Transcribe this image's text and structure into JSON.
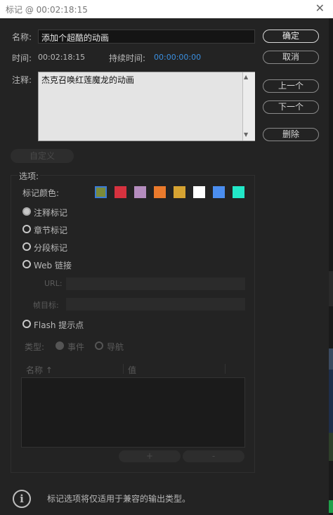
{
  "window": {
    "title": "标记 @ 00:02:18:15",
    "close": "✕"
  },
  "name": {
    "label": "名称:",
    "value": "添加个超酷的动画"
  },
  "time": {
    "label": "时间:",
    "value": "00:02:18:15",
    "duration_label": "持续时间:",
    "duration_value": "00:00:00:00"
  },
  "comment": {
    "label": "注释:",
    "value": "杰克召唤红莲魔龙的动画"
  },
  "buttons": {
    "ok": "确定",
    "cancel": "取消",
    "prev": "上一个",
    "next": "下一个",
    "delete": "删除",
    "custom": "自定义"
  },
  "options": {
    "legend": "选项:",
    "color_label": "标记颜色:",
    "colors": [
      "#7b8a3a",
      "#d6323f",
      "#b48cbe",
      "#ea7a2c",
      "#d6a332",
      "#ffffff",
      "#4b8ef0",
      "#22e8c8"
    ],
    "selected_color_index": 0,
    "types": [
      {
        "label": "注释标记",
        "selected": true
      },
      {
        "label": "章节标记",
        "selected": false
      },
      {
        "label": "分段标记",
        "selected": false
      },
      {
        "label": "Web 链接",
        "selected": false
      }
    ],
    "url_label": "URL:",
    "frame_target_label": "帧目标:",
    "flash_label": "Flash 提示点",
    "kind_label": "类型:",
    "kind_event": "事件",
    "kind_nav": "导航",
    "col_name": "名称",
    "sort_arrow": "↑",
    "col_value": "值",
    "add": "+",
    "remove": "-"
  },
  "footer": {
    "icon": "i",
    "text": "标记选项将仅适用于兼容的输出类型。"
  }
}
